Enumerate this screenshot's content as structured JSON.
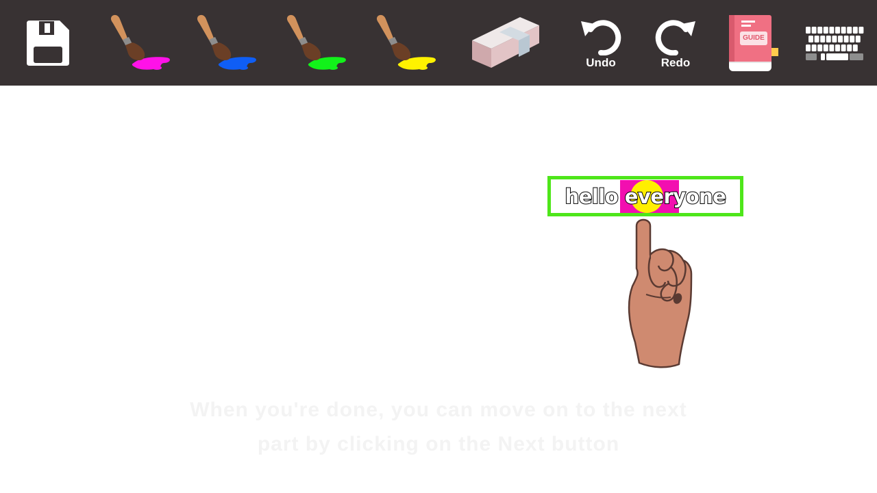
{
  "toolbar": {
    "tools": [
      {
        "id": "save",
        "icon": "floppy-disk-icon"
      },
      {
        "id": "brush-magenta",
        "icon": "paintbrush-icon",
        "color": "#ff12e8"
      },
      {
        "id": "brush-blue",
        "icon": "paintbrush-icon",
        "color": "#0f5ef5"
      },
      {
        "id": "brush-green",
        "icon": "paintbrush-icon",
        "color": "#12f21a"
      },
      {
        "id": "brush-yellow",
        "icon": "paintbrush-icon",
        "color": "#fff200"
      },
      {
        "id": "eraser",
        "icon": "eraser-icon"
      },
      {
        "id": "undo",
        "icon": "undo-arrow-icon",
        "label": "Undo"
      },
      {
        "id": "redo",
        "icon": "redo-arrow-icon",
        "label": "Redo"
      },
      {
        "id": "guide",
        "icon": "guide-book-icon",
        "book_text": "GUIDE"
      },
      {
        "id": "keyboard",
        "icon": "keyboard-icon"
      }
    ],
    "background": "#383233"
  },
  "canvas": {
    "text_box": {
      "text": "hello everyone",
      "border_color": "#4ee61a",
      "highlight_colors": [
        "#f20fb0",
        "#ffef00"
      ]
    },
    "hint_lines": [
      "When you're done, you can move on to the next",
      "part by clicking on the Next button"
    ]
  },
  "colors": {
    "skin": "#cf8a70",
    "outline": "#5a3a32"
  }
}
